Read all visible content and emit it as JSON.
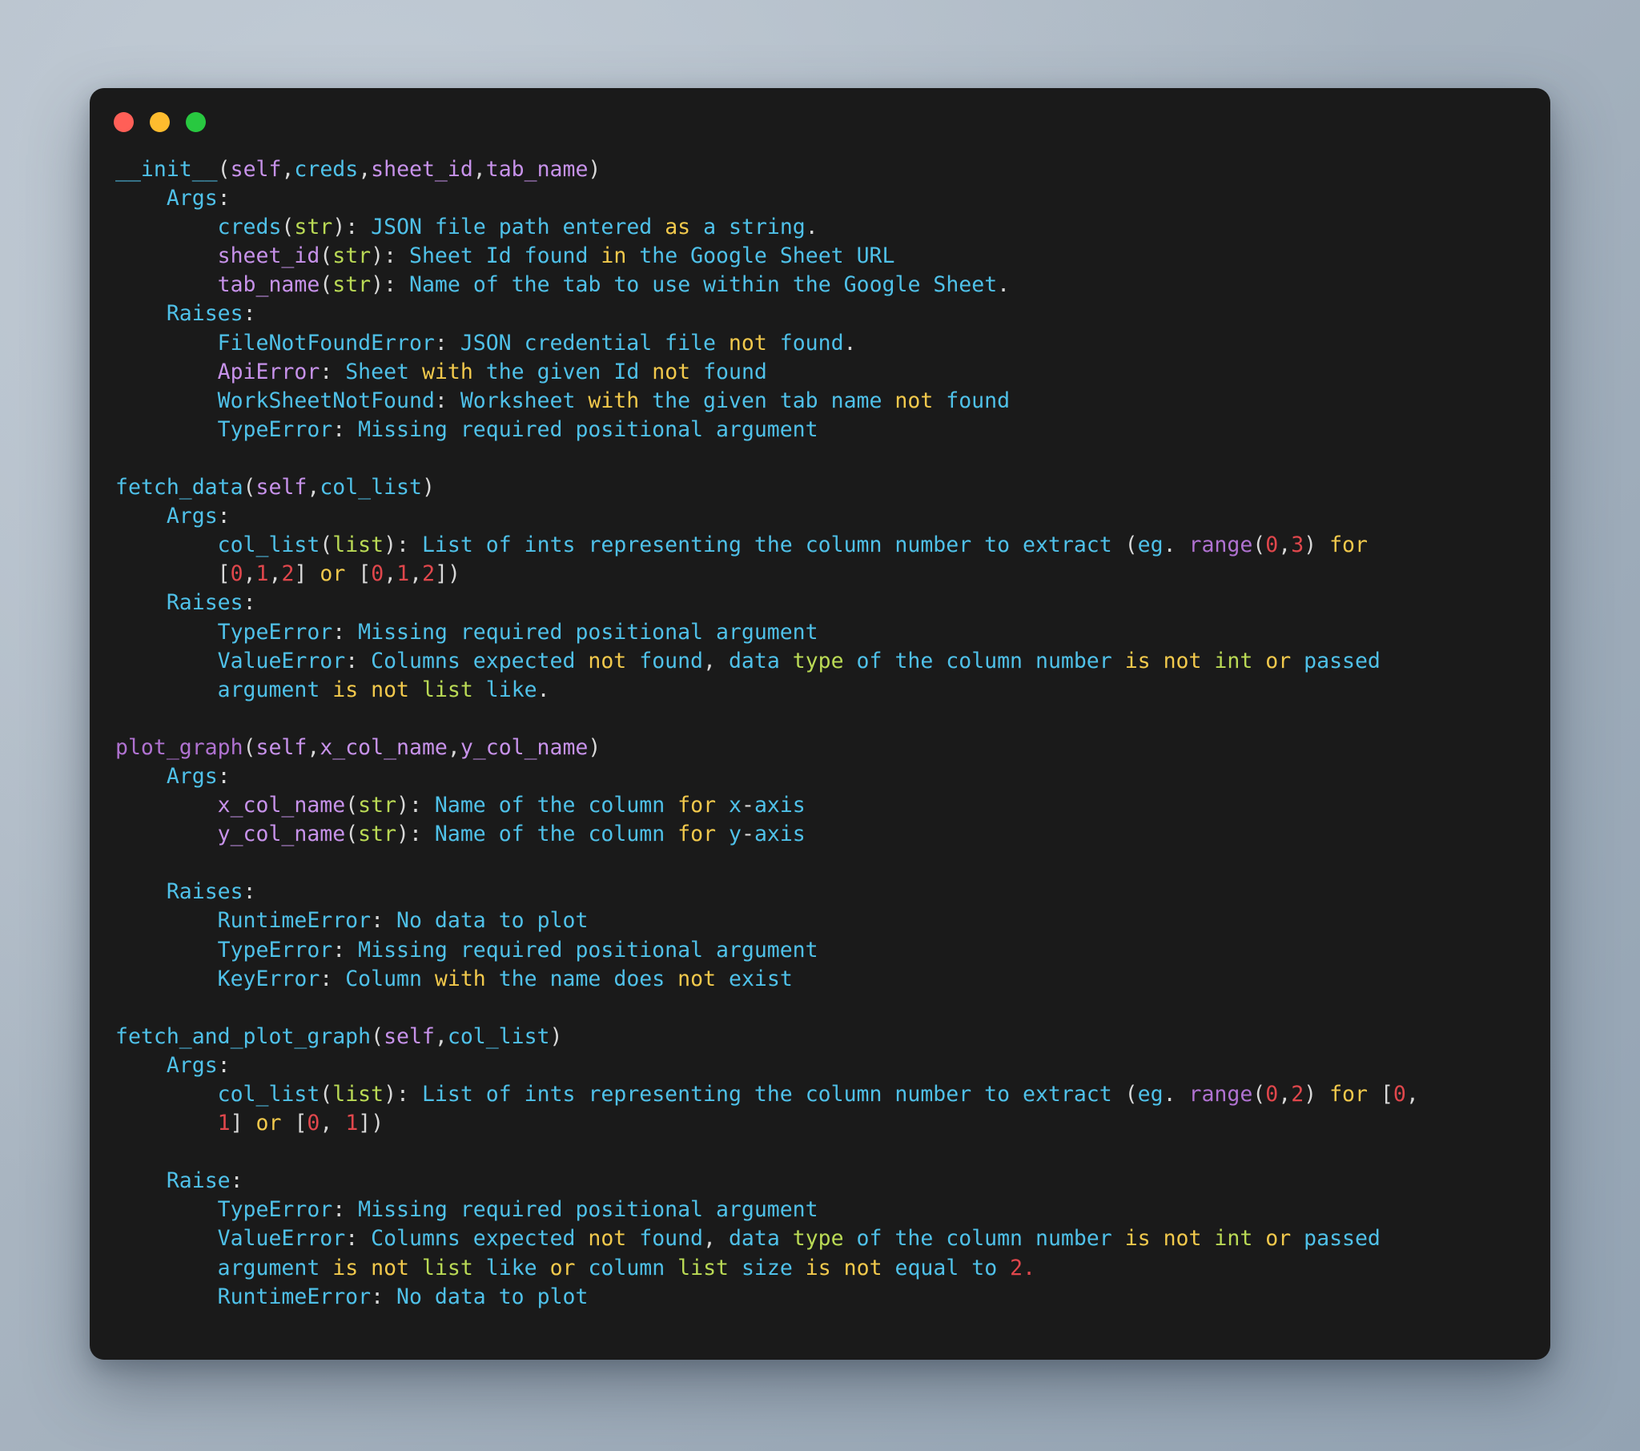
{
  "window": {
    "title": "",
    "traffic_lights": [
      {
        "name": "close",
        "color": "#ff5f57"
      },
      {
        "name": "minimize",
        "color": "#febc2e"
      },
      {
        "name": "maximize",
        "color": "#28c840"
      }
    ],
    "background_color": "#1a1a1a"
  },
  "theme": {
    "background": "#1a1a1a",
    "text": "#4fc1e9",
    "function": "#b072d1",
    "self_param": "#c792ea",
    "keyword": "#f2c94c",
    "builtin": "#bada55",
    "number": "#e0474c",
    "punctuation": "#d8d8d8",
    "page_background_start": "#b3bdc8",
    "page_background_end": "#93a3b3"
  },
  "code": {
    "language": "python",
    "sections": [
      {
        "signature": "__init__(self,creds,sheet_id,tab_name)",
        "args_label": "Args:",
        "args": [
          "creds(str): JSON file path entered as a string.",
          "sheet_id(str): Sheet Id found in the Google Sheet URL",
          "tab_name(str): Name of the tab to use within the Google Sheet."
        ],
        "raises_label": "Raises:",
        "raises": [
          "FileNotFoundError: JSON credential file not found.",
          "ApiError: Sheet with the given Id not found",
          "WorkSheetNotFound: Worksheet with the given tab name not found",
          "TypeError: Missing required positional argument"
        ]
      },
      {
        "signature": "fetch_data(self,col_list)",
        "args_label": "Args:",
        "args": [
          "col_list(list): List of ints representing the column number to extract (eg. range(0,3) for [0,1,2] or [0,1,2])"
        ],
        "raises_label": "Raises:",
        "raises": [
          "TypeError: Missing required positional argument",
          "ValueError: Columns expected not found, data type of the column number is not int or passed argument is not list like."
        ]
      },
      {
        "signature": "plot_graph(self,x_col_name,y_col_name)",
        "args_label": "Args:",
        "args": [
          "x_col_name(str): Name of the column for x-axis",
          "y_col_name(str): Name of the column for y-axis"
        ],
        "raises_label": "Raises:",
        "raises": [
          "RuntimeError: No data to plot",
          "TypeError: Missing required positional argument",
          "KeyError: Column with the name does not exist"
        ]
      },
      {
        "signature": "fetch_and_plot_graph(self,col_list)",
        "args_label": "Args:",
        "args": [
          "col_list(list): List of ints representing the column number to extract (eg. range(0,2) for [0, 1] or [0, 1])"
        ],
        "raises_label": "Raise:",
        "raises": [
          "TypeError: Missing required positional argument",
          "ValueError: Columns expected not found, data type of the column number is not int or passed argument is not list like or column list size is not equal to 2.",
          "RuntimeError: No data to plot"
        ]
      }
    ],
    "lines": [
      {
        "id": "l1",
        "text": "__init__(self,creds,sheet_id,tab_name)"
      },
      {
        "id": "l2",
        "text": "    Args:"
      },
      {
        "id": "l3",
        "text": "        creds(str): JSON file path entered as a string."
      },
      {
        "id": "l4",
        "text": "        sheet_id(str): Sheet Id found in the Google Sheet URL"
      },
      {
        "id": "l5",
        "text": "        tab_name(str): Name of the tab to use within the Google Sheet."
      },
      {
        "id": "l6",
        "text": "    Raises:"
      },
      {
        "id": "l7",
        "text": "        FileNotFoundError: JSON credential file not found."
      },
      {
        "id": "l8",
        "text": "        ApiError: Sheet with the given Id not found"
      },
      {
        "id": "l9",
        "text": "        WorkSheetNotFound: Worksheet with the given tab name not found"
      },
      {
        "id": "l10",
        "text": "        TypeError: Missing required positional argument"
      },
      {
        "id": "l11",
        "text": ""
      },
      {
        "id": "l12",
        "text": "fetch_data(self,col_list)"
      },
      {
        "id": "l13",
        "text": "    Args:"
      },
      {
        "id": "l14",
        "text": "        col_list(list): List of ints representing the column number to extract (eg. range(0,3) for"
      },
      {
        "id": "l15",
        "text": "        [0,1,2] or [0,1,2])"
      },
      {
        "id": "l16",
        "text": "    Raises:"
      },
      {
        "id": "l17",
        "text": "        TypeError: Missing required positional argument"
      },
      {
        "id": "l18",
        "text": "        ValueError: Columns expected not found, data type of the column number is not int or passed"
      },
      {
        "id": "l19",
        "text": "        argument is not list like."
      },
      {
        "id": "l20",
        "text": ""
      },
      {
        "id": "l21",
        "text": "plot_graph(self,x_col_name,y_col_name)"
      },
      {
        "id": "l22",
        "text": "    Args:"
      },
      {
        "id": "l23",
        "text": "        x_col_name(str): Name of the column for x-axis"
      },
      {
        "id": "l24",
        "text": "        y_col_name(str): Name of the column for y-axis"
      },
      {
        "id": "l25",
        "text": ""
      },
      {
        "id": "l26",
        "text": "    Raises:"
      },
      {
        "id": "l27",
        "text": "        RuntimeError: No data to plot"
      },
      {
        "id": "l28",
        "text": "        TypeError: Missing required positional argument"
      },
      {
        "id": "l29",
        "text": "        KeyError: Column with the name does not exist"
      },
      {
        "id": "l30",
        "text": ""
      },
      {
        "id": "l31",
        "text": "fetch_and_plot_graph(self,col_list)"
      },
      {
        "id": "l32",
        "text": "    Args:"
      },
      {
        "id": "l33",
        "text": "        col_list(list): List of ints representing the column number to extract (eg. range(0,2) for [0,"
      },
      {
        "id": "l34",
        "text": "        1] or [0, 1])"
      },
      {
        "id": "l35",
        "text": ""
      },
      {
        "id": "l36",
        "text": "    Raise:"
      },
      {
        "id": "l37",
        "text": "        TypeError: Missing required positional argument"
      },
      {
        "id": "l38",
        "text": "        ValueError: Columns expected not found, data type of the column number is not int or passed"
      },
      {
        "id": "l39",
        "text": "        argument is not list like or column list size is not equal to 2."
      },
      {
        "id": "l40",
        "text": "        RuntimeError: No data to plot"
      }
    ]
  }
}
